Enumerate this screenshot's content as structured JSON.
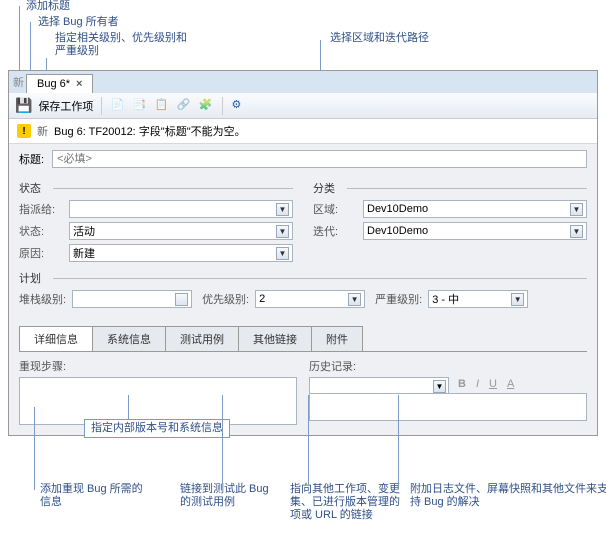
{
  "callouts": {
    "addTitle": "添加标题",
    "selectOwner": "选择 Bug 所有者",
    "specifyLevels": "指定相关级别、优先级别和\n严重级别",
    "selectArea": "选择区域和迭代路径",
    "addRepro": "添加重现 Bug 所需的\n信息",
    "specifyBuild": "指定内部版本号和系统信息",
    "linkTest": "链接到测试此 Bug\n的测试用例",
    "linkOther": "指向其他工作项、变更\n集、已进行版本管理的\n项或 URL 的链接",
    "attach": "附加日志文件、屏幕快照和其他文件来支\n持 Bug 的解决"
  },
  "tab": {
    "label": "Bug 6*"
  },
  "toolbar": {
    "newLabel": "新",
    "saveLabel": "保存工作项"
  },
  "warning": {
    "nLabel": "新",
    "msg": "Bug 6: TF20012: 字段\"标题\"不能为空。"
  },
  "titleRow": {
    "label": "标题:",
    "placeholder": "<必填>"
  },
  "status": {
    "legend": "状态",
    "assignedTo": {
      "label": "指派给:",
      "value": ""
    },
    "state": {
      "label": "状态:",
      "value": "活动"
    },
    "reason": {
      "label": "原因:",
      "value": "新建"
    }
  },
  "classification": {
    "legend": "分类",
    "area": {
      "label": "区域:",
      "value": "Dev10Demo"
    },
    "iteration": {
      "label": "迭代:",
      "value": "Dev10Demo"
    }
  },
  "plan": {
    "legend": "计划",
    "stackRank": {
      "label": "堆栈级别:",
      "value": ""
    },
    "priority": {
      "label": "优先级别:",
      "value": "2"
    },
    "severity": {
      "label": "严重级别:",
      "value": "3 - 中"
    }
  },
  "tabs": {
    "details": "详细信息",
    "system": "系统信息",
    "testcase": "测试用例",
    "other": "其他链接",
    "attach": "附件"
  },
  "detail": {
    "repro": "重现步骤:",
    "history": "历史记录:",
    "bold": "B",
    "italic": "I",
    "underline": "U",
    "a": "A"
  }
}
